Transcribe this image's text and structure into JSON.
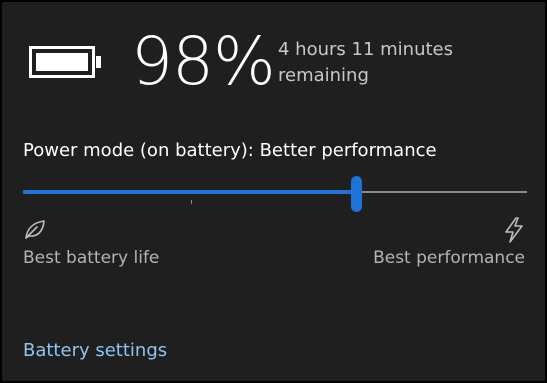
{
  "battery": {
    "icon": "battery-full-icon",
    "percent_text": "98%",
    "charge_level": 0.98,
    "remaining_text": "4 hours 11 minutes remaining"
  },
  "power_mode": {
    "label": "Power mode (on battery): Better performance",
    "slider": {
      "positions": 4,
      "selected_index": 2,
      "selected_fraction": 0.66,
      "accent_color": "#1f73d6",
      "track_color": "#8a8a8a"
    },
    "min_label": "Best battery life",
    "min_icon": "leaf-icon",
    "max_label": "Best performance",
    "max_icon": "lightning-bolt-icon"
  },
  "links": {
    "battery_settings": "Battery settings",
    "link_color": "#8cc4f5"
  },
  "theme": {
    "background": "#1f1f1f",
    "text_primary": "#ffffff",
    "text_secondary": "#b4b4b4"
  }
}
